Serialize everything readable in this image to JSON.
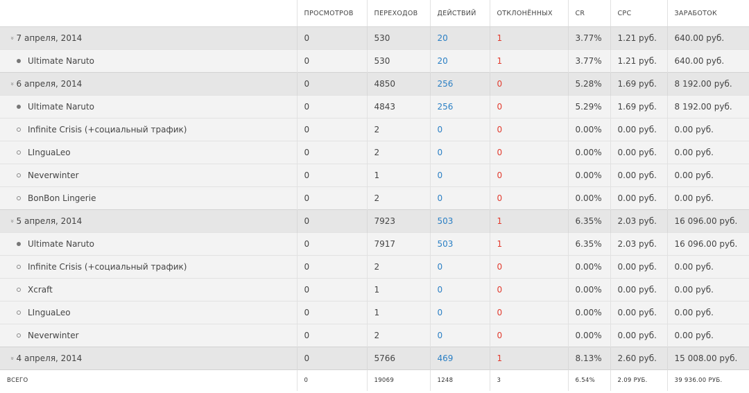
{
  "headers": [
    "",
    "ПРОСМОТРОВ",
    "ПЕРЕХОДОВ",
    "ДЕЙСТВИЙ",
    "ОТКЛОНЁННЫХ",
    "CR",
    "CPC",
    "ЗАРАБОТОК"
  ],
  "rows": [
    {
      "type": "group",
      "name": "7 апреля, 2014",
      "views": "0",
      "clicks": "530",
      "actions": "20",
      "rejected": "1",
      "cr": "3.77%",
      "cpc": "1.21 руб.",
      "earnings": "640.00 руб."
    },
    {
      "type": "item",
      "active": true,
      "name": "Ultimate Naruto",
      "views": "0",
      "clicks": "530",
      "actions": "20",
      "rejected": "1",
      "cr": "3.77%",
      "cpc": "1.21 руб.",
      "earnings": "640.00 руб."
    },
    {
      "type": "group",
      "name": "6 апреля, 2014",
      "views": "0",
      "clicks": "4850",
      "actions": "256",
      "rejected": "0",
      "cr": "5.28%",
      "cpc": "1.69 руб.",
      "earnings": "8 192.00 руб."
    },
    {
      "type": "item",
      "active": true,
      "name": "Ultimate Naruto",
      "views": "0",
      "clicks": "4843",
      "actions": "256",
      "rejected": "0",
      "cr": "5.29%",
      "cpc": "1.69 руб.",
      "earnings": "8 192.00 руб."
    },
    {
      "type": "item",
      "active": false,
      "name": "Infinite Crisis (+социальный трафик)",
      "views": "0",
      "clicks": "2",
      "actions": "0",
      "rejected": "0",
      "cr": "0.00%",
      "cpc": "0.00 руб.",
      "earnings": "0.00 руб."
    },
    {
      "type": "item",
      "active": false,
      "name": "LInguaLeo",
      "views": "0",
      "clicks": "2",
      "actions": "0",
      "rejected": "0",
      "cr": "0.00%",
      "cpc": "0.00 руб.",
      "earnings": "0.00 руб."
    },
    {
      "type": "item",
      "active": false,
      "name": "Neverwinter",
      "views": "0",
      "clicks": "1",
      "actions": "0",
      "rejected": "0",
      "cr": "0.00%",
      "cpc": "0.00 руб.",
      "earnings": "0.00 руб."
    },
    {
      "type": "item",
      "active": false,
      "name": "BonBon Lingerie",
      "views": "0",
      "clicks": "2",
      "actions": "0",
      "rejected": "0",
      "cr": "0.00%",
      "cpc": "0.00 руб.",
      "earnings": "0.00 руб."
    },
    {
      "type": "group",
      "name": "5 апреля, 2014",
      "views": "0",
      "clicks": "7923",
      "actions": "503",
      "rejected": "1",
      "cr": "6.35%",
      "cpc": "2.03 руб.",
      "earnings": "16 096.00 руб."
    },
    {
      "type": "item",
      "active": true,
      "name": "Ultimate Naruto",
      "views": "0",
      "clicks": "7917",
      "actions": "503",
      "rejected": "1",
      "cr": "6.35%",
      "cpc": "2.03 руб.",
      "earnings": "16 096.00 руб."
    },
    {
      "type": "item",
      "active": false,
      "name": "Infinite Crisis (+социальный трафик)",
      "views": "0",
      "clicks": "2",
      "actions": "0",
      "rejected": "0",
      "cr": "0.00%",
      "cpc": "0.00 руб.",
      "earnings": "0.00 руб."
    },
    {
      "type": "item",
      "active": false,
      "name": "Xcraft",
      "views": "0",
      "clicks": "1",
      "actions": "0",
      "rejected": "0",
      "cr": "0.00%",
      "cpc": "0.00 руб.",
      "earnings": "0.00 руб."
    },
    {
      "type": "item",
      "active": false,
      "name": "LInguaLeo",
      "views": "0",
      "clicks": "1",
      "actions": "0",
      "rejected": "0",
      "cr": "0.00%",
      "cpc": "0.00 руб.",
      "earnings": "0.00 руб."
    },
    {
      "type": "item",
      "active": false,
      "name": "Neverwinter",
      "views": "0",
      "clicks": "2",
      "actions": "0",
      "rejected": "0",
      "cr": "0.00%",
      "cpc": "0.00 руб.",
      "earnings": "0.00 руб."
    },
    {
      "type": "group",
      "name": "4 апреля, 2014",
      "views": "0",
      "clicks": "5766",
      "actions": "469",
      "rejected": "1",
      "cr": "8.13%",
      "cpc": "2.60 руб.",
      "earnings": "15 008.00 руб."
    }
  ],
  "total": {
    "name": "ВСЕГО",
    "views": "0",
    "clicks": "19069",
    "actions": "1248",
    "rejected": "3",
    "cr": "6.54%",
    "cpc": "2.09 РУБ.",
    "earnings": "39 936.00 РУБ."
  },
  "colors": {
    "link": "#2a7fc4",
    "rejected": "#e23b2e",
    "group_bg": "#e6e6e6",
    "item_bg": "#f3f3f3"
  },
  "icons": {
    "group": "chevron-double-down-icon",
    "active_item": "filled-dot-icon",
    "inactive_item": "empty-dot-icon"
  }
}
